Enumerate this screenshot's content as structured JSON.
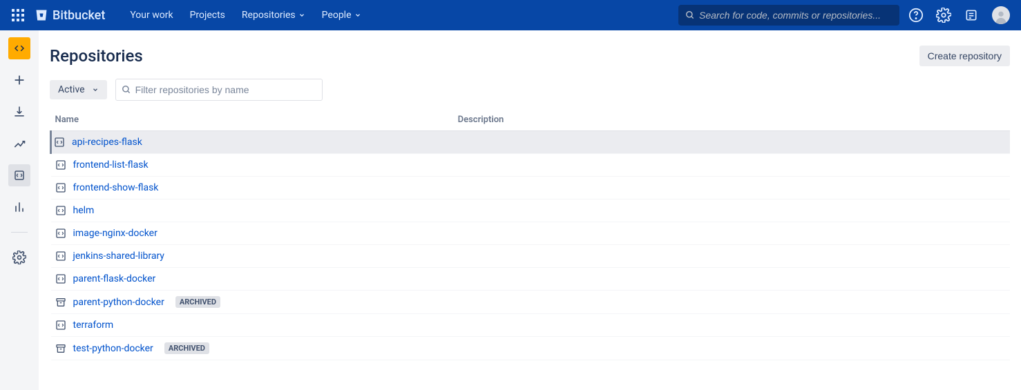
{
  "topnav": {
    "brand": "Bitbucket",
    "items": [
      {
        "label": "Your work",
        "dropdown": false
      },
      {
        "label": "Projects",
        "dropdown": false
      },
      {
        "label": "Repositories",
        "dropdown": true
      },
      {
        "label": "People",
        "dropdown": true
      }
    ],
    "search_placeholder": "Search for code, commits or repositories..."
  },
  "page": {
    "title": "Repositories",
    "create_label": "Create repository",
    "filter_status": "Active",
    "filter_placeholder": "Filter repositories by name"
  },
  "table": {
    "col_name": "Name",
    "col_desc": "Description"
  },
  "repos": [
    {
      "name": "api-recipes-flask",
      "description": "",
      "archived": false,
      "highlighted": true
    },
    {
      "name": "frontend-list-flask",
      "description": "",
      "archived": false,
      "highlighted": false
    },
    {
      "name": "frontend-show-flask",
      "description": "",
      "archived": false,
      "highlighted": false
    },
    {
      "name": "helm",
      "description": "",
      "archived": false,
      "highlighted": false
    },
    {
      "name": "image-nginx-docker",
      "description": "",
      "archived": false,
      "highlighted": false
    },
    {
      "name": "jenkins-shared-library",
      "description": "",
      "archived": false,
      "highlighted": false
    },
    {
      "name": "parent-flask-docker",
      "description": "",
      "archived": false,
      "highlighted": false
    },
    {
      "name": "parent-python-docker",
      "description": "",
      "archived": true,
      "highlighted": false
    },
    {
      "name": "terraform",
      "description": "",
      "archived": false,
      "highlighted": false
    },
    {
      "name": "test-python-docker",
      "description": "",
      "archived": true,
      "highlighted": false
    }
  ],
  "labels": {
    "archived": "ARCHIVED"
  }
}
